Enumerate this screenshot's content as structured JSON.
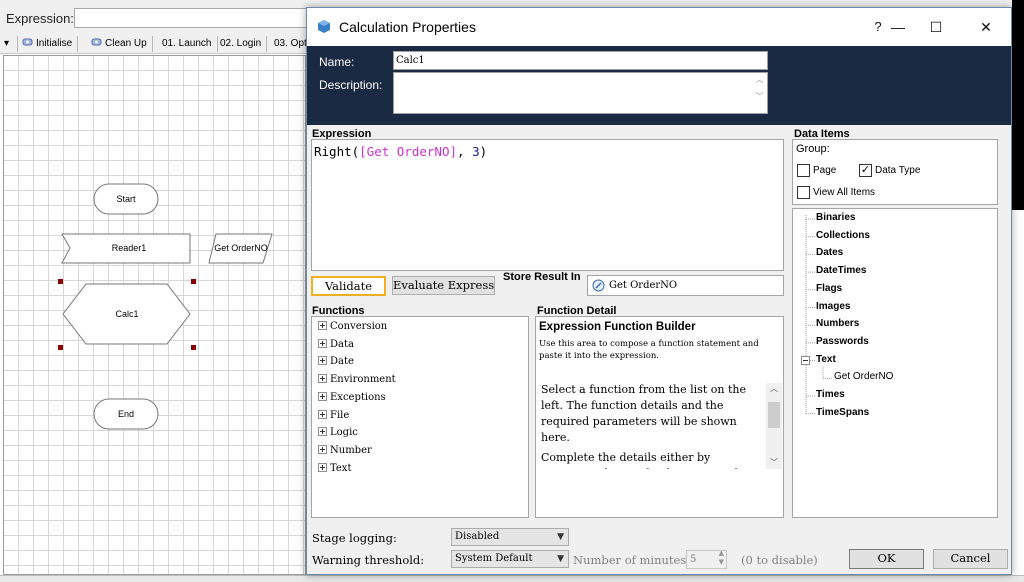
{
  "background": {
    "expression_label": "Expression:",
    "tabs": [
      {
        "label": "Initialise",
        "icon": "gear-icon"
      },
      {
        "label": "Clean Up",
        "icon": "gear-icon"
      },
      {
        "label": "01. Launch"
      },
      {
        "label": "02. Login"
      },
      {
        "label": "03. Opt"
      }
    ],
    "stages": {
      "start": "Start",
      "reader": "Reader1",
      "data_item": "Get OrderNO",
      "calc": "Calc1",
      "end": "End"
    }
  },
  "dialog": {
    "title": "Calculation Properties",
    "buttons": {
      "help": "?",
      "minimize": "—",
      "maximize": "☐",
      "close": "✕"
    },
    "name_label": "Name:",
    "name_value": "Calc1",
    "description_label": "Description:",
    "description_value": "",
    "expression": {
      "title": "Expression",
      "fn": "Right(",
      "param": "[Get OrderNO]",
      "sep": ", ",
      "num": "3",
      "close": ")"
    },
    "validate_label": "Validate",
    "evaluate_label": "Evaluate Expressi",
    "store_result_label": "Store Result In",
    "store_result_value": "Get OrderNO",
    "functions": {
      "title": "Functions",
      "items": [
        "Conversion",
        "Data",
        "Date",
        "Environment",
        "Exceptions",
        "File",
        "Logic",
        "Number",
        "Text"
      ]
    },
    "function_detail": {
      "title": "Function Detail",
      "heading": "Expression Function Builder",
      "intro": "Use this area to compose a function statement and paste it into the expression.",
      "para1": "Select a function from the list on the left. The function details and the required parameters will be shown here.",
      "para2": "Complete the details either by entering values or by dragging in data items"
    },
    "data_items": {
      "title": "Data Items",
      "group_label": "Group:",
      "page_label": "Page",
      "page_checked": false,
      "data_type_label": "Data Type",
      "data_type_checked": true,
      "view_all_label": "View All Items",
      "view_all_checked": false,
      "tree": [
        {
          "label": "Binaries",
          "level": 0
        },
        {
          "label": "Collections",
          "level": 0
        },
        {
          "label": "Dates",
          "level": 0
        },
        {
          "label": "DateTimes",
          "level": 0
        },
        {
          "label": "Flags",
          "level": 0
        },
        {
          "label": "Images",
          "level": 0
        },
        {
          "label": "Numbers",
          "level": 0
        },
        {
          "label": "Passwords",
          "level": 0
        },
        {
          "label": "Text",
          "level": 0,
          "expanded": true
        },
        {
          "label": "Get OrderNO",
          "level": 1
        },
        {
          "label": "Times",
          "level": 0
        },
        {
          "label": "TimeSpans",
          "level": 0
        }
      ]
    },
    "stage_logging_label": "Stage logging:",
    "stage_logging_value": "Disabled",
    "warning_label": "Warning threshold:",
    "warning_value": "System Default",
    "minutes_label": "Number of minutes",
    "minutes_value": "5",
    "disable_hint": "(0 to disable)",
    "ok_label": "OK",
    "cancel_label": "Cancel"
  },
  "colors": {
    "header_bg": "#1b2a43",
    "expression_param": "#cc33cc",
    "expression_number": "#1a1aaa",
    "validate_border": "#f0b020"
  }
}
